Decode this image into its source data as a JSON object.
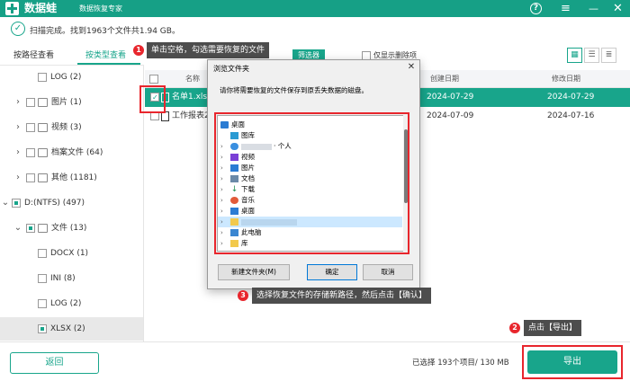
{
  "app": {
    "name": "数据蛙",
    "subtitle": "数据恢复专家",
    "help_glyph": "?",
    "menu_glyph": "≡",
    "minimize_glyph": "—",
    "close_glyph": "✕"
  },
  "scan": {
    "status_text": "扫描完成。找到1963个文件共1.94 GB。",
    "status_icon": "checkmark-circle-icon"
  },
  "tabs": [
    {
      "label": "按路径查看",
      "active": false
    },
    {
      "label": "按类型查看",
      "active": true
    }
  ],
  "tree": [
    {
      "label": "LOG (2)",
      "chevron": "",
      "checkbox": "empty",
      "icon": "none"
    },
    {
      "label": "图片 (1)",
      "chevron": ">",
      "checkbox": "empty",
      "icon": "image-icon"
    },
    {
      "label": "视频 (3)",
      "chevron": ">",
      "checkbox": "empty",
      "icon": "video-icon"
    },
    {
      "label": "档案文件 (64)",
      "chevron": ">",
      "checkbox": "empty",
      "icon": "archive-icon"
    },
    {
      "label": "其他 (1181)",
      "chevron": ">",
      "checkbox": "empty",
      "icon": "folder-icon"
    },
    {
      "label": "D:(NTFS) (497)",
      "chevron": "v",
      "checkbox": "partial",
      "icon": "none"
    },
    {
      "label": "文件 (13)",
      "chevron": "v",
      "checkbox": "partial",
      "icon": "document-icon"
    },
    {
      "label": "DOCX (1)",
      "chevron": "",
      "checkbox": "empty",
      "icon": "none"
    },
    {
      "label": "INI (8)",
      "chevron": "",
      "checkbox": "empty",
      "icon": "none"
    },
    {
      "label": "LOG (2)",
      "chevron": "",
      "checkbox": "empty",
      "icon": "none"
    },
    {
      "label": "XLSX (2)",
      "chevron": "",
      "checkbox": "partial",
      "icon": "none",
      "selected": true
    }
  ],
  "toolbar": {
    "filter_label": "筛选器",
    "only_deleted_label": "仅显示删除项",
    "view_icons": [
      "grid-view-icon",
      "list-view-icon",
      "detail-view-icon"
    ]
  },
  "table": {
    "columns": [
      "名称",
      "创建日期",
      "修改日期"
    ],
    "rows": [
      {
        "name": "名单1.xlsx",
        "created": "2024-07-29",
        "modified": "2024-07-29",
        "checked": true,
        "selected": true
      },
      {
        "name": "工作报表20",
        "created": "2024-07-09",
        "modified": "2024-07-16",
        "checked": false,
        "selected": false
      }
    ]
  },
  "hints": [
    {
      "number": "1",
      "text": "单击空格，勾选需要恢复的文件"
    },
    {
      "number": "2",
      "text": "点击【导出】"
    },
    {
      "number": "3",
      "text": "选择恢复文件的存储新路径，然后点击【确认】"
    }
  ],
  "dialog": {
    "title": "浏览文件夹",
    "close_glyph": "✕",
    "description": "请你将需要恢复的文件保存到原丢失数据的磁盘。",
    "nodes": [
      {
        "label": "桌面",
        "icon": "desktop-icon",
        "arrow": "v",
        "level": 0
      },
      {
        "label": "图库",
        "icon": "gallery-icon",
        "arrow": "",
        "level": 1
      },
      {
        "label": "· 个人",
        "icon": "cloud-icon",
        "arrow": ">",
        "level": 1,
        "blurred": true
      },
      {
        "label": "视频",
        "icon": "video-icon",
        "arrow": ">",
        "level": 1
      },
      {
        "label": "图片",
        "icon": "image-icon",
        "arrow": ">",
        "level": 1
      },
      {
        "label": "文档",
        "icon": "document-icon",
        "arrow": ">",
        "level": 1
      },
      {
        "label": "下载",
        "icon": "download-icon",
        "arrow": ">",
        "level": 1
      },
      {
        "label": "音乐",
        "icon": "music-icon",
        "arrow": ">",
        "level": 1
      },
      {
        "label": "桌面",
        "icon": "desktop-icon",
        "arrow": ">",
        "level": 1
      },
      {
        "label": "",
        "icon": "folder-icon",
        "arrow": ">",
        "level": 1,
        "blurred": true,
        "highlight": true
      },
      {
        "label": "此电脑",
        "icon": "computer-icon",
        "arrow": ">",
        "level": 1
      },
      {
        "label": "库",
        "icon": "library-icon",
        "arrow": ">",
        "level": 1
      }
    ],
    "new_folder_label": "新建文件夹(M)",
    "ok_label": "确定",
    "cancel_label": "取消"
  },
  "bottom": {
    "back_label": "返回",
    "selection_info": "已选择 193个项目/ 130 MB",
    "export_label": "导出"
  },
  "colors": {
    "accent": "#16a086",
    "highlight_box": "#e8262d",
    "hint_bg": "#4d4d4d"
  }
}
